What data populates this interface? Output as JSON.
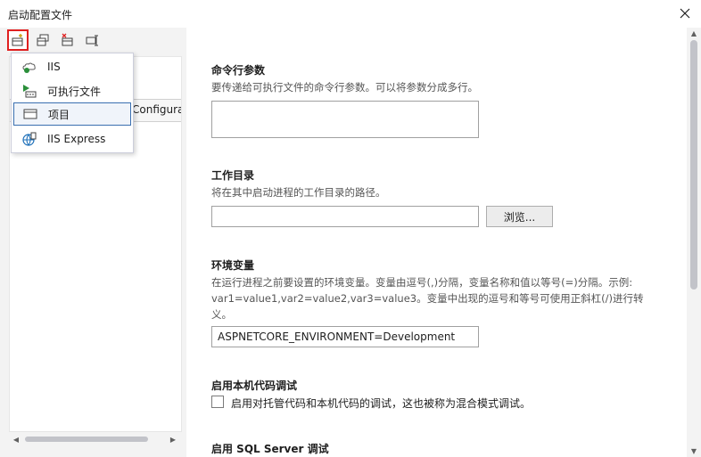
{
  "window": {
    "title": "启动配置文件"
  },
  "toolbar": {
    "buttons": [
      {
        "icon": "new-profile-icon"
      },
      {
        "icon": "copy-profile-icon"
      },
      {
        "icon": "delete-profile-icon"
      },
      {
        "icon": "rename-profile-icon"
      }
    ]
  },
  "profile_list": {
    "row_text": "Configura"
  },
  "dropdown": {
    "items": [
      {
        "label": "IIS",
        "icon": "iis-icon"
      },
      {
        "label": "可执行文件",
        "icon": "executable-icon"
      },
      {
        "label": "项目",
        "icon": "project-icon",
        "selected": true
      },
      {
        "label": "IIS Express",
        "icon": "iis-express-icon"
      }
    ]
  },
  "sections": {
    "args": {
      "title": "命令行参数",
      "desc": "要传递给可执行文件的命令行参数。可以将参数分成多行。",
      "value": ""
    },
    "workdir": {
      "title": "工作目录",
      "desc": "将在其中启动进程的工作目录的路径。",
      "value": "",
      "browse_label": "浏览..."
    },
    "env": {
      "title": "环境变量",
      "desc": "在运行进程之前要设置的环境变量。变量由逗号(,)分隔，变量名称和值以等号(=)分隔。示例: var1=value1,var2=value2,var3=value3。变量中出现的逗号和等号可使用正斜杠(/)进行转义。",
      "value": "ASPNETCORE_ENVIRONMENT=Development"
    },
    "native": {
      "title": "启用本机代码调试",
      "checkbox_label": "启用对托管代码和本机代码的调试，这也被称为混合模式调试。",
      "checked": false
    },
    "sql": {
      "title": "启用 SQL Server 调试"
    }
  }
}
